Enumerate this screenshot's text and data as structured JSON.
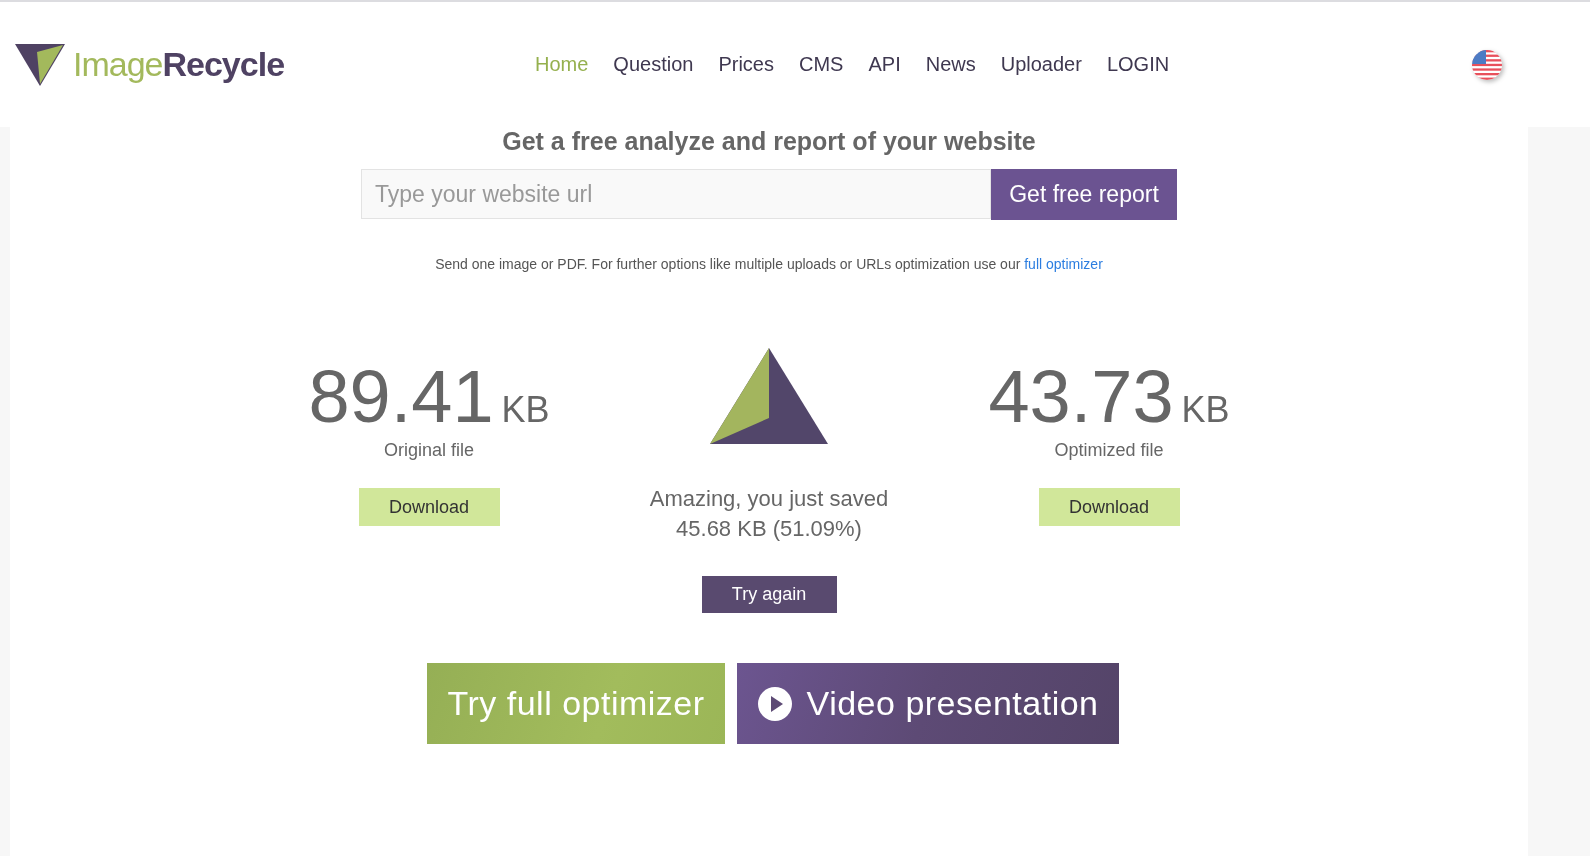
{
  "logo": {
    "light": "Image",
    "bold": "Recycle"
  },
  "nav": [
    {
      "label": "Home",
      "selected": true
    },
    {
      "label": "Question",
      "selected": false
    },
    {
      "label": "Prices",
      "selected": false
    },
    {
      "label": "CMS",
      "selected": false
    },
    {
      "label": "API",
      "selected": false
    },
    {
      "label": "News",
      "selected": false
    },
    {
      "label": "Uploader",
      "selected": false
    },
    {
      "label": "LOGIN",
      "selected": false
    }
  ],
  "report": {
    "title": "Get a free analyze and report of your website",
    "placeholder": "Type your website url",
    "button": "Get free report"
  },
  "note": {
    "text": "Send one image or PDF. For further options like multiple uploads or URLs optimization use our",
    "link": "full optimizer"
  },
  "original": {
    "size": "89.41",
    "unit": "KB",
    "label": "Original file",
    "button": "Download"
  },
  "saved": {
    "line1": "Amazing, you just saved",
    "line2": "45.68 KB (51.09%)",
    "button": "Try again"
  },
  "optimized": {
    "size": "43.73",
    "unit": "KB",
    "label": "Optimized file",
    "button": "Download"
  },
  "cta": [
    {
      "kind": "green",
      "label": "Try full optimizer"
    },
    {
      "kind": "video",
      "label": "Video presentation"
    }
  ]
}
